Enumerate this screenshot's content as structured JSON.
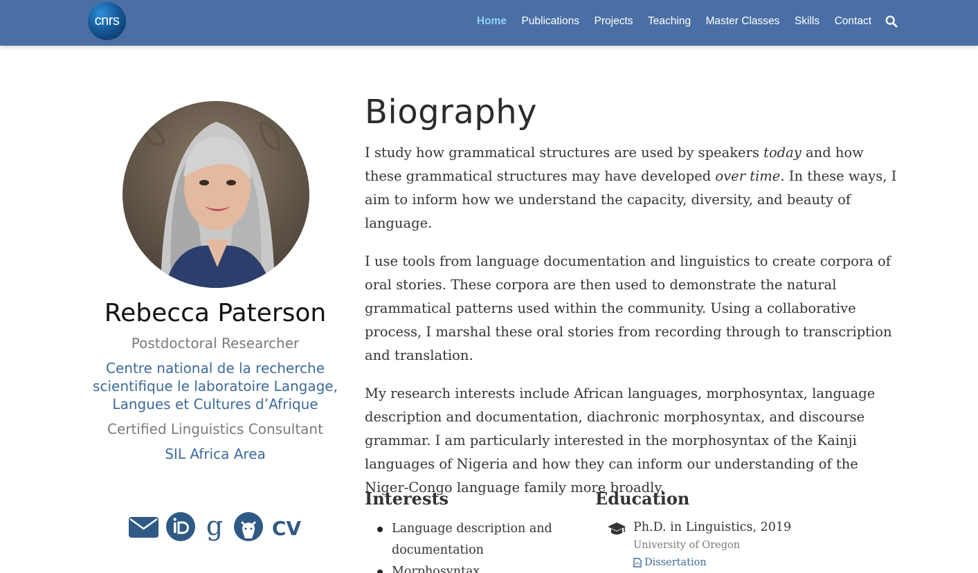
{
  "nav": {
    "logo_text": "cnrs",
    "links": [
      {
        "label": "Home",
        "active": true
      },
      {
        "label": "Publications"
      },
      {
        "label": "Projects"
      },
      {
        "label": "Teaching"
      },
      {
        "label": "Master Classes"
      },
      {
        "label": "Skills"
      },
      {
        "label": "Contact"
      }
    ],
    "search_icon": "search-icon"
  },
  "profile": {
    "name": "Rebecca Paterson",
    "role": "Postdoctoral Researcher",
    "organization": "Centre national de la recherche scientifique le laboratoire Langage, Langues et Cultures d’Afrique",
    "role2": "Certified Linguistics Consultant",
    "organization2": "SIL Africa Area",
    "social_icons": [
      "envelope-icon",
      "orcid-icon",
      "google-scholar-icon",
      "github-icon",
      "cv-icon"
    ],
    "cv_label": "CV"
  },
  "biography": {
    "title": "Biography",
    "p1_a": "I study how grammatical structures are used by speakers ",
    "p1_em1": "today",
    "p1_b": " and how these grammatical structures may have developed ",
    "p1_em2": "over time",
    "p1_c": ". In these ways, I aim to inform how we understand the capacity, diversity, and beauty of language.",
    "p2": "I use tools from language documentation and linguistics to create corpora of oral stories. These corpora are then used to demonstrate the natural grammatical patterns used within the community. Using a collaborative process, I marshal these oral stories from recording through to transcription and translation.",
    "p3": "My research interests include African languages, morphosyntax, language description and documentation, diachronic morphosyntax, and discourse grammar. I am particularly interested in the morphosyntax of the Kainji languages of Nigeria and how they can inform our understanding of the Niger-Congo language family more broadly."
  },
  "interests": {
    "title": "Interests",
    "items": [
      "Language description and documentation",
      "Morphosyntax"
    ]
  },
  "education": {
    "title": "Education",
    "items": [
      {
        "degree": "Ph.D. in Linguistics, 2019",
        "institution": "University of Oregon",
        "link_label": "Dissertation"
      }
    ]
  },
  "colors": {
    "navbar": "#4a6fa5",
    "active_nav": "#8fd3f4",
    "link": "#3d6a99",
    "icon": "#2f5a86"
  }
}
